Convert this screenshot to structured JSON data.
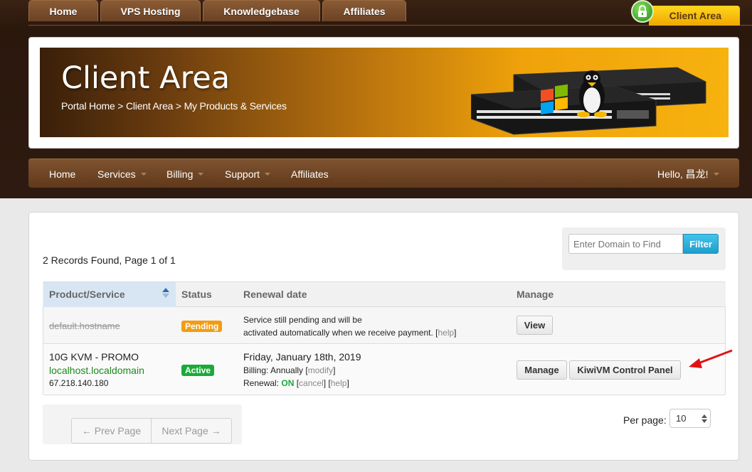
{
  "top_nav": {
    "tabs": [
      {
        "label": "Home"
      },
      {
        "label": "VPS Hosting"
      },
      {
        "label": "Knowledgebase"
      },
      {
        "label": "Affiliates"
      }
    ],
    "client_area_label": "Client Area",
    "lock_icon": "lock-icon"
  },
  "banner": {
    "title": "Client Area",
    "breadcrumb": "Portal Home > Client Area > My Products & Services"
  },
  "main_nav": {
    "home": "Home",
    "services": "Services",
    "billing": "Billing",
    "support": "Support",
    "affiliates": "Affiliates",
    "user": "Hello, 昌龙!"
  },
  "content": {
    "records_summary": "2 Records Found, Page 1 of 1",
    "filter": {
      "placeholder": "Enter Domain to Find",
      "button": "Filter"
    },
    "table": {
      "headers": [
        "Product/Service",
        "Status",
        "Renewal date",
        "Manage"
      ],
      "rows": [
        {
          "hostname": "default.hostname",
          "status": "Pending",
          "note_line_1": "Service still pending and will be",
          "note_line_2_text": "activated automatically when we receive payment. [",
          "help": "help",
          "close_bracket": "]",
          "action": "View"
        },
        {
          "product": "10G KVM - PROMO",
          "domain": "localhost.localdomain",
          "ip": "67.218.140.180",
          "status": "Active",
          "renewal_date": "Friday, January 18th, 2019",
          "billing_label": "Billing: Annually [",
          "modify": "modify",
          "renewal_label": "Renewal: ",
          "renewal_state": "ON",
          "cancel": "cancel",
          "help": "help",
          "manage": "Manage",
          "control_panel": "KiwiVM Control Panel"
        }
      ]
    },
    "pagination": {
      "prev": "← Prev Page",
      "next": "Next Page →"
    },
    "per_page": {
      "label": "Per page:",
      "value": "10"
    }
  },
  "colors": {
    "header_brown": "#2e1a10",
    "nav_brown": "#6e4526",
    "accent_gold": "#f7b20f",
    "pending": "#f39c12",
    "active": "#1aaa3a",
    "filter_blue": "#1c9fcc",
    "annotation_red": "#e21212"
  }
}
